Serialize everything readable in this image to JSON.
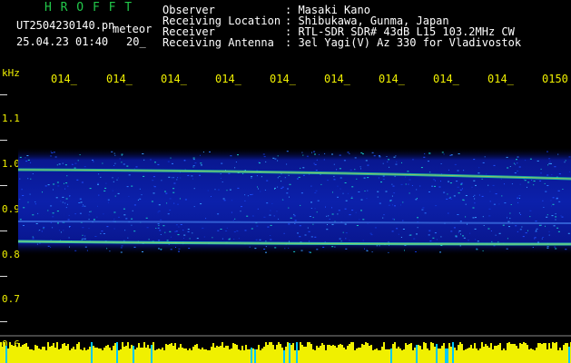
{
  "header": {
    "brand": "H R O F F T",
    "filename": "UT2504230140.pn",
    "mode": "meteor",
    "datetime": "25.04.23 01:40",
    "extra": "20_",
    "fields": [
      {
        "label": "Observer",
        "value": ": Masaki Kano"
      },
      {
        "label": "Receiving Location",
        "value": ": Shibukawa, Gunma, Japan"
      },
      {
        "label": "Receiver",
        "value": ": RTL-SDR SDR# 43dB L15 103.2MHz CW"
      },
      {
        "label": "Receiving Antenna",
        "value": ": 3el Yagi(V) Az 330 for Vladivostok"
      }
    ]
  },
  "plot": {
    "unit_label": "kHz",
    "y_ticks": [
      "1.1",
      "1.0",
      "0.9",
      "0.8",
      "0.7",
      "0.6"
    ],
    "time_labels": [
      "014_",
      "014_",
      "014_",
      "014_",
      "014_",
      "014_",
      "014_",
      "014_",
      "014_",
      "0150"
    ],
    "colors": {
      "background": "#000000",
      "band": "#0a1aa0",
      "yellow": "#f0f000",
      "cyan": "#00c8ff"
    }
  }
}
